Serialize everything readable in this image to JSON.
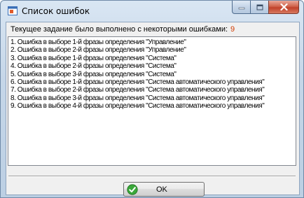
{
  "window": {
    "title": "Список ошибок"
  },
  "header": {
    "message": "Текущее задание было выполнено с некоторыми ошибками:",
    "error_count": "9"
  },
  "errors": [
    "1. Ошибка в выборе 1-й фразы определения \"Управление\"",
    "2. Ошибка в выборе 2-й фразы определения \"Управление\"",
    "3. Ошибка в выборе 1-й фразы определения \"Система\"",
    "4. Ошибка в выборе 2-й фразы определения \"Система\"",
    "5. Ошибка в выборе 3-й фразы определения \"Система\"",
    "6. Ошибка в выборе 1-й фразы определения \"Система автоматического управления\"",
    "7. Ошибка в выборе 2-й фразы определения \"Система автоматического управления\"",
    "8. Ошибка в выборе 3-й фразы определения \"Система автоматического управления\"",
    "9. Ошибка в выборе 4-й фразы определения \"Система автоматического управления\""
  ],
  "buttons": {
    "ok_label": "OK"
  },
  "icons": {
    "app": "app-window-icon",
    "ok": "checkmark-icon",
    "minimize": "minimize-icon",
    "maximize": "maximize-icon",
    "close": "close-icon"
  },
  "colors": {
    "error_count": "#d03a00",
    "close_button": "#c1412a",
    "ok_check": "#2f9a2f"
  }
}
